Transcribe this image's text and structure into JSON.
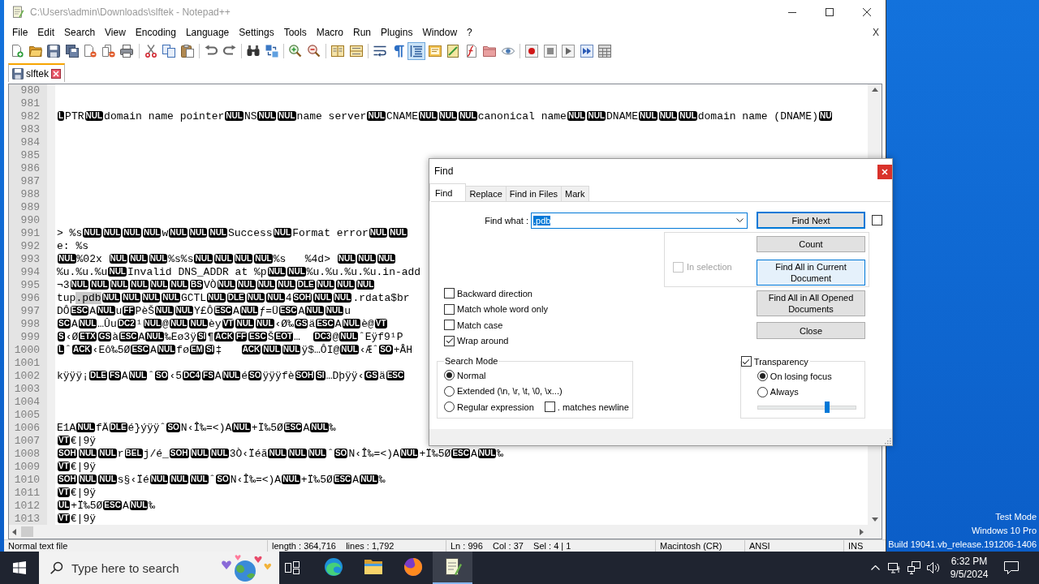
{
  "window": {
    "title": "C:\\Users\\admin\\Downloads\\slftek - Notepad++"
  },
  "menu": {
    "items": [
      "File",
      "Edit",
      "Search",
      "View",
      "Encoding",
      "Language",
      "Settings",
      "Tools",
      "Macro",
      "Run",
      "Plugins",
      "Window",
      "?"
    ],
    "close_label": "X"
  },
  "toolbar": {
    "buttons": [
      {
        "pressed": false
      },
      {
        "pressed": false
      },
      {
        "pressed": false
      },
      {
        "pressed": false
      },
      {
        "pressed": false
      },
      {
        "pressed": false
      },
      {
        "pressed": false
      },
      {
        "pressed": false
      },
      {
        "pressed": false
      },
      {
        "pressed": false
      },
      {
        "pressed": false
      },
      {
        "pressed": false
      },
      {
        "pressed": false
      },
      {
        "pressed": false
      },
      {
        "pressed": false
      },
      {
        "pressed": false
      },
      {
        "pressed": false
      },
      {
        "pressed": false
      },
      {
        "pressed": false
      },
      {
        "pressed": false
      },
      {
        "pressed": true
      },
      {
        "pressed": false
      },
      {
        "pressed": false
      },
      {
        "pressed": false
      },
      {
        "pressed": false
      },
      {
        "pressed": false
      },
      {
        "pressed": false
      },
      {
        "pressed": false
      },
      {
        "pressed": false
      },
      {
        "pressed": false
      },
      {
        "pressed": false
      }
    ]
  },
  "tabs": [
    {
      "label": "slftek",
      "selected": true
    }
  ],
  "editor": {
    "lines": [
      {
        "number": "980"
      },
      {
        "number": "981"
      },
      {
        "number": "982",
        "segments": [
          {
            "kind": "ctrl",
            "text": "L"
          },
          {
            "kind": "text",
            "text": "PTR"
          },
          {
            "kind": "ctrl",
            "text": "NUL"
          },
          {
            "kind": "text",
            "text": "domain name pointer"
          },
          {
            "kind": "ctrl",
            "text": "NUL"
          },
          {
            "kind": "text",
            "text": "NS"
          },
          {
            "kind": "ctrl",
            "text": "NUL"
          },
          {
            "kind": "ctrl",
            "text": "NUL"
          },
          {
            "kind": "text",
            "text": "name server"
          },
          {
            "kind": "ctrl",
            "text": "NUL"
          },
          {
            "kind": "text",
            "text": "CNAME"
          },
          {
            "kind": "ctrl",
            "text": "NUL"
          },
          {
            "kind": "ctrl",
            "text": "NUL"
          },
          {
            "kind": "ctrl",
            "text": "NUL"
          },
          {
            "kind": "text",
            "text": "canonical name"
          },
          {
            "kind": "ctrl",
            "text": "NUL"
          },
          {
            "kind": "ctrl",
            "text": "NUL"
          },
          {
            "kind": "text",
            "text": "DNAME"
          },
          {
            "kind": "ctrl",
            "text": "NUL"
          },
          {
            "kind": "ctrl",
            "text": "NUL"
          },
          {
            "kind": "ctrl",
            "text": "NUL"
          },
          {
            "kind": "text",
            "text": "domain name (DNAME)"
          },
          {
            "kind": "ctrl",
            "text": "NU"
          }
        ]
      },
      {
        "number": "983"
      },
      {
        "number": "984"
      },
      {
        "number": "985"
      },
      {
        "number": "986"
      },
      {
        "number": "987"
      },
      {
        "number": "988"
      },
      {
        "number": "989"
      },
      {
        "number": "990"
      },
      {
        "number": "991",
        "segments": [
          {
            "kind": "text",
            "text": "> %s"
          },
          {
            "kind": "ctrl",
            "text": "NUL"
          },
          {
            "kind": "ctrl",
            "text": "NUL"
          },
          {
            "kind": "ctrl",
            "text": "NUL"
          },
          {
            "kind": "ctrl",
            "text": "NUL"
          },
          {
            "kind": "text",
            "text": "w"
          },
          {
            "kind": "ctrl",
            "text": "NUL"
          },
          {
            "kind": "ctrl",
            "text": "NUL"
          },
          {
            "kind": "ctrl",
            "text": "NUL"
          },
          {
            "kind": "text",
            "text": "Success"
          },
          {
            "kind": "ctrl",
            "text": "NUL"
          },
          {
            "kind": "text",
            "text": "Format error"
          },
          {
            "kind": "ctrl",
            "text": "NUL"
          },
          {
            "kind": "ctrl",
            "text": "NUL"
          }
        ]
      },
      {
        "number": "992",
        "segments": [
          {
            "kind": "text",
            "text": "e: %s"
          }
        ]
      },
      {
        "number": "993",
        "segments": [
          {
            "kind": "ctrl",
            "text": "NUL"
          },
          {
            "kind": "text",
            "text": "%02x "
          },
          {
            "kind": "ctrl",
            "text": "NUL"
          },
          {
            "kind": "ctrl",
            "text": "NUL"
          },
          {
            "kind": "ctrl",
            "text": "NUL"
          },
          {
            "kind": "text",
            "text": "%s%s"
          },
          {
            "kind": "ctrl",
            "text": "NUL"
          },
          {
            "kind": "ctrl",
            "text": "NUL"
          },
          {
            "kind": "ctrl",
            "text": "NUL"
          },
          {
            "kind": "ctrl",
            "text": "NUL"
          },
          {
            "kind": "text",
            "text": "%s   %4d> "
          },
          {
            "kind": "ctrl",
            "text": "NUL"
          },
          {
            "kind": "ctrl",
            "text": "NUL"
          },
          {
            "kind": "ctrl",
            "text": "NUL"
          }
        ]
      },
      {
        "number": "994",
        "segments": [
          {
            "kind": "text",
            "text": "%u.%u.%u"
          },
          {
            "kind": "ctrl",
            "text": "NUL"
          },
          {
            "kind": "text",
            "text": "Invalid DNS_ADDR at %p"
          },
          {
            "kind": "ctrl",
            "text": "NUL"
          },
          {
            "kind": "ctrl",
            "text": "NUL"
          },
          {
            "kind": "text",
            "text": "%u.%u.%u.%u.in-add"
          }
        ]
      },
      {
        "number": "995",
        "segments": [
          {
            "kind": "text",
            "text": "¬3"
          },
          {
            "kind": "ctrl",
            "text": "NUL"
          },
          {
            "kind": "ctrl",
            "text": "NUL"
          },
          {
            "kind": "ctrl",
            "text": "NUL"
          },
          {
            "kind": "ctrl",
            "text": "NUL"
          },
          {
            "kind": "ctrl",
            "text": "NUL"
          },
          {
            "kind": "ctrl",
            "text": "NUL"
          },
          {
            "kind": "ctrl",
            "text": "BS"
          },
          {
            "kind": "text",
            "text": "VÒ"
          },
          {
            "kind": "ctrl",
            "text": "NUL"
          },
          {
            "kind": "ctrl",
            "text": "NUL"
          },
          {
            "kind": "ctrl",
            "text": "NUL"
          },
          {
            "kind": "ctrl",
            "text": "NUL"
          },
          {
            "kind": "ctrl",
            "text": "DLE"
          },
          {
            "kind": "ctrl",
            "text": "NUL"
          },
          {
            "kind": "ctrl",
            "text": "NUL"
          },
          {
            "kind": "ctrl",
            "text": "NUL"
          }
        ]
      },
      {
        "number": "996",
        "segments": [
          {
            "kind": "text",
            "text": "tup"
          },
          {
            "kind": "match",
            "text": ".pdb"
          },
          {
            "kind": "ctrl",
            "text": "NUL"
          },
          {
            "kind": "ctrl",
            "text": "NUL"
          },
          {
            "kind": "ctrl",
            "text": "NUL"
          },
          {
            "kind": "ctrl",
            "text": "NUL"
          },
          {
            "kind": "text",
            "text": "GCTL"
          },
          {
            "kind": "ctrl",
            "text": "NUL"
          },
          {
            "kind": "ctrl",
            "text": "DLE"
          },
          {
            "kind": "ctrl",
            "text": "NUL"
          },
          {
            "kind": "ctrl",
            "text": "NUL"
          },
          {
            "kind": "text",
            "text": "4"
          },
          {
            "kind": "ctrl",
            "text": "SOH"
          },
          {
            "kind": "ctrl",
            "text": "NUL"
          },
          {
            "kind": "ctrl",
            "text": "NUL"
          },
          {
            "kind": "text",
            "text": ".rdata$br"
          }
        ]
      },
      {
        "number": "997",
        "segments": [
          {
            "kind": "text",
            "text": "DÔ"
          },
          {
            "kind": "ctrl",
            "text": "ESC"
          },
          {
            "kind": "text",
            "text": "A"
          },
          {
            "kind": "ctrl",
            "text": "NUL"
          },
          {
            "kind": "text",
            "text": "u"
          },
          {
            "kind": "ctrl",
            "text": "FF"
          },
          {
            "kind": "text",
            "text": "PèŠ"
          },
          {
            "kind": "ctrl",
            "text": "NUL"
          },
          {
            "kind": "ctrl",
            "text": "NUL"
          },
          {
            "kind": "text",
            "text": "Y£Ô"
          },
          {
            "kind": "ctrl",
            "text": "ESC"
          },
          {
            "kind": "text",
            "text": "A"
          },
          {
            "kind": "ctrl",
            "text": "NUL"
          },
          {
            "kind": "text",
            "text": "ƒ=Ü"
          },
          {
            "kind": "ctrl",
            "text": "ESC"
          },
          {
            "kind": "text",
            "text": "A"
          },
          {
            "kind": "ctrl",
            "text": "NUL"
          },
          {
            "kind": "ctrl",
            "text": "NUL"
          },
          {
            "kind": "text",
            "text": "u"
          }
        ]
      },
      {
        "number": "998",
        "segments": [
          {
            "kind": "ctrl",
            "text": "SC"
          },
          {
            "kind": "text",
            "text": "A"
          },
          {
            "kind": "ctrl",
            "text": "NUL"
          },
          {
            "kind": "text",
            "text": "…Ûu"
          },
          {
            "kind": "ctrl",
            "text": "DC2"
          },
          {
            "kind": "text",
            "text": "¹"
          },
          {
            "kind": "ctrl",
            "text": "NUL"
          },
          {
            "kind": "text",
            "text": "@"
          },
          {
            "kind": "ctrl",
            "text": "NUL"
          },
          {
            "kind": "ctrl",
            "text": "NUL"
          },
          {
            "kind": "text",
            "text": "èy"
          },
          {
            "kind": "ctrl",
            "text": "VT"
          },
          {
            "kind": "ctrl",
            "text": "NUL"
          },
          {
            "kind": "ctrl",
            "text": "NUL"
          },
          {
            "kind": "text",
            "text": "‹Ø‰"
          },
          {
            "kind": "ctrl",
            "text": "GS"
          },
          {
            "kind": "text",
            "text": "ä"
          },
          {
            "kind": "ctrl",
            "text": "ESC"
          },
          {
            "kind": "text",
            "text": "A"
          },
          {
            "kind": "ctrl",
            "text": "NUL"
          },
          {
            "kind": "text",
            "text": "è@"
          },
          {
            "kind": "ctrl",
            "text": "VT"
          }
        ]
      },
      {
        "number": "999",
        "segments": [
          {
            "kind": "ctrl",
            "text": "S"
          },
          {
            "kind": "text",
            "text": "‹Ø"
          },
          {
            "kind": "ctrl",
            "text": "ETX"
          },
          {
            "kind": "ctrl",
            "text": "GS"
          },
          {
            "kind": "text",
            "text": "à"
          },
          {
            "kind": "ctrl",
            "text": "ESC"
          },
          {
            "kind": "text",
            "text": "A"
          },
          {
            "kind": "ctrl",
            "text": "NUL"
          },
          {
            "kind": "text",
            "text": "‰Eø3ÿ"
          },
          {
            "kind": "ctrl",
            "text": "SI"
          },
          {
            "kind": "text",
            "text": "¶"
          },
          {
            "kind": "ctrl",
            "text": "ACK"
          },
          {
            "kind": "ctrl",
            "text": "FF"
          },
          {
            "kind": "ctrl",
            "text": "ESC"
          },
          {
            "kind": "text",
            "text": "Š"
          },
          {
            "kind": "ctrl",
            "text": "EOT"
          },
          {
            "kind": "text",
            "text": "…  "
          },
          {
            "kind": "ctrl",
            "text": "DC3"
          },
          {
            "kind": "text",
            "text": "@"
          },
          {
            "kind": "ctrl",
            "text": "NUL"
          },
          {
            "kind": "text",
            "text": "ˆEÿf9¹P"
          }
        ]
      },
      {
        "number": "1000",
        "segments": [
          {
            "kind": "ctrl",
            "text": "L"
          },
          {
            "kind": "text",
            "text": "ˆ"
          },
          {
            "kind": "ctrl",
            "text": "ACK"
          },
          {
            "kind": "text",
            "text": "‹Eô‰5Ø"
          },
          {
            "kind": "ctrl",
            "text": "ESC"
          },
          {
            "kind": "text",
            "text": "A"
          },
          {
            "kind": "ctrl",
            "text": "NUL"
          },
          {
            "kind": "text",
            "text": "fø"
          },
          {
            "kind": "ctrl",
            "text": "EM"
          },
          {
            "kind": "ctrl",
            "text": "SI"
          },
          {
            "kind": "text",
            "text": "‡   "
          },
          {
            "kind": "ctrl",
            "text": "ACK"
          },
          {
            "kind": "ctrl",
            "text": "NUL"
          },
          {
            "kind": "ctrl",
            "text": "NUL"
          },
          {
            "kind": "text",
            "text": "ÿ$…ÔI@"
          },
          {
            "kind": "ctrl",
            "text": "NUL"
          },
          {
            "kind": "text",
            "text": "‹Æˆ"
          },
          {
            "kind": "ctrl",
            "text": "SO"
          },
          {
            "kind": "text",
            "text": "+ÂH"
          }
        ]
      },
      {
        "number": "1001"
      },
      {
        "number": "1002",
        "segments": [
          {
            "kind": "text",
            "text": "kÿÿÿ¡"
          },
          {
            "kind": "ctrl",
            "text": "DLE"
          },
          {
            "kind": "ctrl",
            "text": "FS"
          },
          {
            "kind": "text",
            "text": "A"
          },
          {
            "kind": "ctrl",
            "text": "NUL"
          },
          {
            "kind": "text",
            "text": "ˆ"
          },
          {
            "kind": "ctrl",
            "text": "SO"
          },
          {
            "kind": "text",
            "text": "‹5"
          },
          {
            "kind": "ctrl",
            "text": "DC4"
          },
          {
            "kind": "ctrl",
            "text": "FS"
          },
          {
            "kind": "text",
            "text": "A"
          },
          {
            "kind": "ctrl",
            "text": "NUL"
          },
          {
            "kind": "text",
            "text": "é"
          },
          {
            "kind": "ctrl",
            "text": "SO"
          },
          {
            "kind": "text",
            "text": "ÿÿÿfè"
          },
          {
            "kind": "ctrl",
            "text": "SOH"
          },
          {
            "kind": "ctrl",
            "text": "SI"
          },
          {
            "kind": "text",
            "text": "…Dþÿÿ‹"
          },
          {
            "kind": "ctrl",
            "text": "GS"
          },
          {
            "kind": "text",
            "text": "ä"
          },
          {
            "kind": "ctrl",
            "text": "ESC"
          }
        ]
      },
      {
        "number": "1003"
      },
      {
        "number": "1004"
      },
      {
        "number": "1005"
      },
      {
        "number": "1006",
        "segments": [
          {
            "kind": "text",
            "text": "E1A"
          },
          {
            "kind": "ctrl",
            "text": "NUL"
          },
          {
            "kind": "text",
            "text": "fÄ"
          },
          {
            "kind": "ctrl",
            "text": "DLE"
          },
          {
            "kind": "text",
            "text": "é}ýÿÿˆ"
          },
          {
            "kind": "ctrl",
            "text": "SO"
          },
          {
            "kind": "text",
            "text": "N‹Î‰=<)A"
          },
          {
            "kind": "ctrl",
            "text": "NUL"
          },
          {
            "kind": "text",
            "text": "+Ï‰5Ø"
          },
          {
            "kind": "ctrl",
            "text": "ESC"
          },
          {
            "kind": "text",
            "text": "A"
          },
          {
            "kind": "ctrl",
            "text": "NUL"
          },
          {
            "kind": "text",
            "text": "‰"
          }
        ]
      },
      {
        "number": "1007",
        "segments": [
          {
            "kind": "ctrl",
            "text": "VT"
          },
          {
            "kind": "text",
            "text": "€|9ÿ"
          }
        ]
      },
      {
        "number": "1008",
        "segments": [
          {
            "kind": "ctrl",
            "text": "SOH"
          },
          {
            "kind": "ctrl",
            "text": "NUL"
          },
          {
            "kind": "ctrl",
            "text": "NUL"
          },
          {
            "kind": "text",
            "text": "r"
          },
          {
            "kind": "ctrl",
            "text": "BEL"
          },
          {
            "kind": "text",
            "text": "j/é_"
          },
          {
            "kind": "ctrl",
            "text": "SOH"
          },
          {
            "kind": "ctrl",
            "text": "NUL"
          },
          {
            "kind": "ctrl",
            "text": "NUL"
          },
          {
            "kind": "text",
            "text": "3Ò‹Ïéã"
          },
          {
            "kind": "ctrl",
            "text": "NUL"
          },
          {
            "kind": "ctrl",
            "text": "NUL"
          },
          {
            "kind": "ctrl",
            "text": "NUL"
          },
          {
            "kind": "text",
            "text": "ˆ"
          },
          {
            "kind": "ctrl",
            "text": "SO"
          },
          {
            "kind": "text",
            "text": "N‹Î‰=<)A"
          },
          {
            "kind": "ctrl",
            "text": "NUL"
          },
          {
            "kind": "text",
            "text": "+Ï‰5Ø"
          },
          {
            "kind": "ctrl",
            "text": "ESC"
          },
          {
            "kind": "text",
            "text": "A"
          },
          {
            "kind": "ctrl",
            "text": "NUL"
          },
          {
            "kind": "text",
            "text": "‰"
          }
        ]
      },
      {
        "number": "1009",
        "segments": [
          {
            "kind": "ctrl",
            "text": "VT"
          },
          {
            "kind": "text",
            "text": "€|9ÿ"
          }
        ]
      },
      {
        "number": "1010",
        "segments": [
          {
            "kind": "ctrl",
            "text": "SOH"
          },
          {
            "kind": "ctrl",
            "text": "NUL"
          },
          {
            "kind": "ctrl",
            "text": "NUL"
          },
          {
            "kind": "text",
            "text": "s§‹Ïé"
          },
          {
            "kind": "ctrl",
            "text": "NUL"
          },
          {
            "kind": "ctrl",
            "text": "NUL"
          },
          {
            "kind": "ctrl",
            "text": "NUL"
          },
          {
            "kind": "text",
            "text": "ˆ"
          },
          {
            "kind": "ctrl",
            "text": "SO"
          },
          {
            "kind": "text",
            "text": "N‹Î‰=<)A"
          },
          {
            "kind": "ctrl",
            "text": "NUL"
          },
          {
            "kind": "text",
            "text": "+Ï‰5Ø"
          },
          {
            "kind": "ctrl",
            "text": "ESC"
          },
          {
            "kind": "text",
            "text": "A"
          },
          {
            "kind": "ctrl",
            "text": "NUL"
          },
          {
            "kind": "text",
            "text": "‰"
          }
        ]
      },
      {
        "number": "1011",
        "segments": [
          {
            "kind": "ctrl",
            "text": "VT"
          },
          {
            "kind": "text",
            "text": "€|9ÿ"
          }
        ]
      },
      {
        "number": "1012",
        "segments": [
          {
            "kind": "ctrl",
            "text": "UL"
          },
          {
            "kind": "text",
            "text": "+Ï‰5Ø"
          },
          {
            "kind": "ctrl",
            "text": "ESC"
          },
          {
            "kind": "text",
            "text": "A"
          },
          {
            "kind": "ctrl",
            "text": "NUL"
          },
          {
            "kind": "text",
            "text": "‰"
          }
        ]
      },
      {
        "number": "1013",
        "segments": [
          {
            "kind": "ctrl",
            "text": "VT"
          },
          {
            "kind": "text",
            "text": "€|9ÿ"
          }
        ]
      }
    ]
  },
  "status_bar": [
    "Normal text file",
    "length : 364,716    lines : 1,792",
    "Ln : 996    Col : 37    Sel : 4 | 1",
    "Macintosh (CR)",
    "ANSI",
    "INS"
  ],
  "find_dialog": {
    "title": "Find",
    "tabs": [
      {
        "label": "Find",
        "selected": true
      },
      {
        "label": "Replace",
        "selected": false
      },
      {
        "label": "Find in Files",
        "selected": false
      },
      {
        "label": "Mark",
        "selected": false
      }
    ],
    "find_what": {
      "label": "Find what :",
      "value": ".pdb",
      "text_selected": true
    },
    "buttons": [
      {
        "label": "Find Next",
        "default": true,
        "hovered": false
      },
      {
        "label": "Count",
        "default": false,
        "hovered": false
      },
      {
        "label": "Find All in Current Document",
        "default": false,
        "hovered": true
      },
      {
        "label": "Find All in All Opened Documents",
        "default": false,
        "hovered": false
      },
      {
        "label": "Close",
        "default": false,
        "hovered": false
      }
    ],
    "side_checkbox": {
      "checked": false
    },
    "in_selection": {
      "label": "In selection",
      "checked": false,
      "disabled": true
    },
    "options": [
      {
        "label": "Backward direction",
        "checked": false
      },
      {
        "label": "Match whole word only",
        "checked": false
      },
      {
        "label": "Match case",
        "checked": false
      },
      {
        "label": "Wrap around",
        "checked": true
      }
    ],
    "search_mode": {
      "title": "Search Mode",
      "options": [
        {
          "label": "Normal",
          "selected": true
        },
        {
          "label": "Extended (\\n, \\r, \\t, \\0, \\x...)",
          "selected": false
        },
        {
          "label": "Regular expression",
          "selected": false
        }
      ],
      "dot_newline": {
        "label": ". matches newline",
        "checked": false
      }
    },
    "transparency": {
      "label": "Transparency",
      "checked": true,
      "options": [
        {
          "label": "On losing focus",
          "selected": true
        },
        {
          "label": "Always",
          "selected": false
        }
      ],
      "level": 0.71
    }
  },
  "taskbar": {
    "search": {
      "placeholder": "Type here to search"
    },
    "apps": [
      {
        "selected": false
      },
      {
        "selected": false
      },
      {
        "selected": false
      },
      {
        "selected": true
      }
    ],
    "time": "6:32 PM",
    "date": "9/5/2024"
  },
  "os_notice": [
    "Test Mode",
    "Windows 10 Pro",
    "Build 19041.vb_release.191206-1406"
  ]
}
